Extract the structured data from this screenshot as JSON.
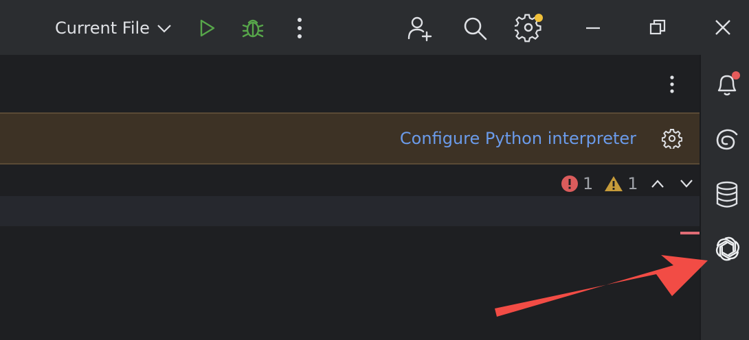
{
  "toolbar": {
    "run_configuration_label": "Current File",
    "icons": [
      "chevron-down-icon",
      "run-icon",
      "debug-icon",
      "more-vertical-icon",
      "add-user-icon",
      "search-icon",
      "settings-icon"
    ],
    "settings_badge_color": "#f0c03a"
  },
  "window_controls": [
    "minimize-icon",
    "restore-icon",
    "close-icon"
  ],
  "banner": {
    "link_label": "Configure Python interpreter",
    "link_color": "#6b9bea",
    "background": "#3d3225"
  },
  "inspections": {
    "errors": "1",
    "warnings": "1",
    "error_color": "#db5c5c",
    "warning_color": "#c69b3a"
  },
  "right_toolbar": {
    "icons": [
      "notifications-icon",
      "ai-assistant-icon",
      "database-icon",
      "chatgpt-icon"
    ],
    "notification_badge_color": "#e55b5b"
  },
  "annotation": {
    "arrow_color": "#f24c45"
  }
}
